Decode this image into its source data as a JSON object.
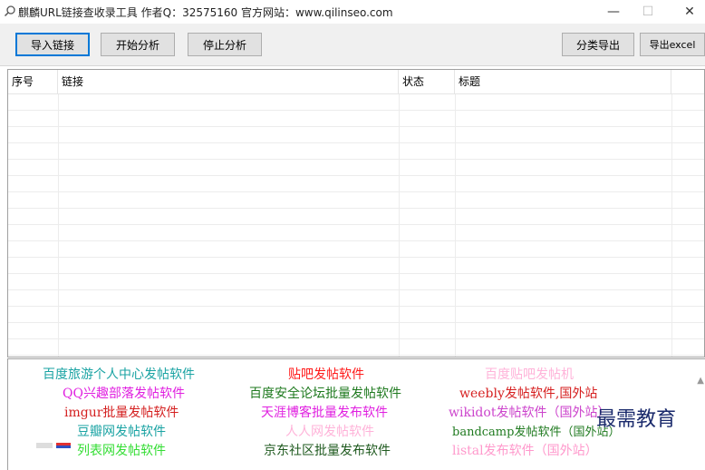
{
  "window": {
    "title": "麒麟URL链接查收录工具 作者Q：32575160 官方网站：www.qilinseo.com",
    "minimize": "—",
    "maximize": "☐",
    "close": "✕"
  },
  "toolbar": {
    "import": "导入链接",
    "start": "开始分析",
    "stop": "停止分析",
    "export_category": "分类导出",
    "export_excel": "导出excel"
  },
  "table": {
    "columns": [
      "序号",
      "链接",
      "状态",
      "标题"
    ]
  },
  "ads": [
    {
      "text": "百度旅游个人中心发帖软件",
      "color": "#1aa3a3"
    },
    {
      "text": "贴吧发帖软件",
      "color": "#ff1a1a"
    },
    {
      "text": "百度贴吧发帖机",
      "color": "#ffb3d9"
    },
    {
      "text": "QQ兴趣部落发帖软件",
      "color": "#e020e0"
    },
    {
      "text": "百度安全论坛批量发帖软件",
      "color": "#1f7a1f"
    },
    {
      "text": "weebly发帖软件,国外站",
      "color": "#d62020"
    },
    {
      "text": "imgur批量发帖软件",
      "color": "#d42020"
    },
    {
      "text": "天涯博客批量发布软件",
      "color": "#e020e0"
    },
    {
      "text": "wikidot发帖软件（国外站）",
      "color": "#cc44cc"
    },
    {
      "text": "豆瓣网发帖软件",
      "color": "#1aa3a3"
    },
    {
      "text": "人人网发帖软件",
      "color": "#ffb3d9"
    },
    {
      "text": "bandcamp发帖软件（国外站）",
      "color": "#1f7a1f"
    },
    {
      "text": "列表网发帖软件",
      "color": "#33dd33"
    },
    {
      "text": "京东社区批量发布软件",
      "color": "#1f5a1f"
    },
    {
      "text": "listal发布软件（国外站）",
      "color": "#ff99cc"
    }
  ],
  "watermark": "最需教育"
}
